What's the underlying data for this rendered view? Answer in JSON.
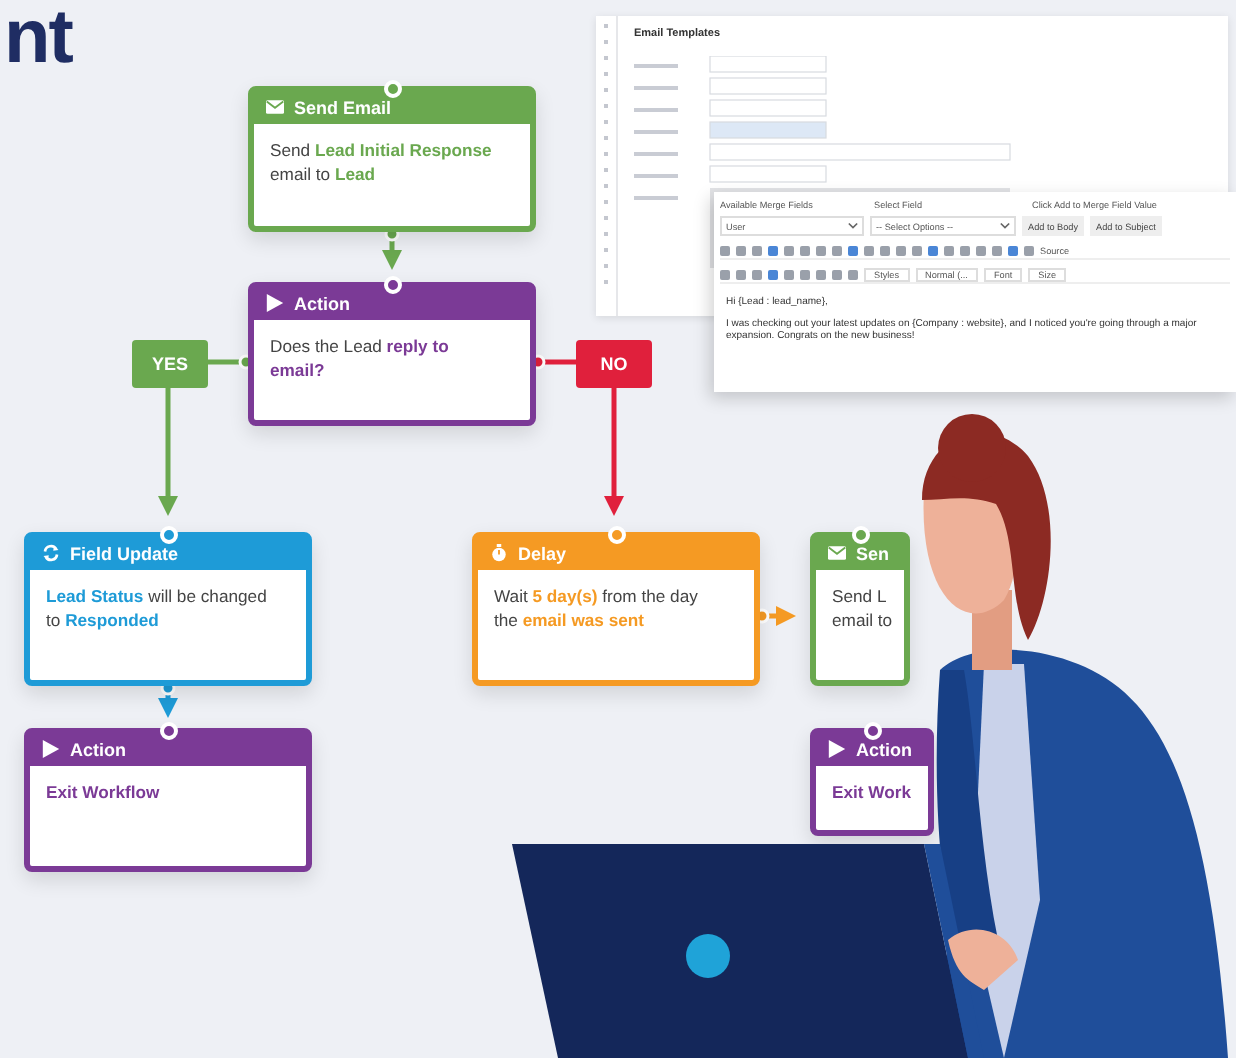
{
  "heading": {
    "text": "nt"
  },
  "email_template": {
    "title": "Email Templates",
    "merge_panel": {
      "labels": [
        "Available Merge Fields",
        "Select Field",
        "Click Add to Merge Field Value"
      ],
      "merge_field": {
        "value": "User"
      },
      "select_field": {
        "value": "-- Select Options --"
      },
      "buttons": [
        "Add to Body",
        "Add to Subject"
      ],
      "toolbar_source": "Source",
      "format_dropdowns": [
        "Styles",
        "Normal (...",
        "Font",
        "Size"
      ],
      "greeting": "Hi {Lead : lead_name},",
      "body": "I was checking out your latest updates on {Company : website}, and I noticed you're going through a major expansion. Congrats on the new business!"
    }
  },
  "nodes": [
    {
      "kind": "send_email",
      "title": "Send Email",
      "lines": [
        "Send **Lead Initial Response**",
        "email to **Lead**"
      ]
    },
    {
      "kind": "action",
      "title": "Action",
      "lines": [
        "Does the Lead **reply to**",
        "**email?**"
      ]
    },
    {
      "kind": "field_update",
      "title": "Field Update",
      "lines": [
        "**Lead Status** will be changed",
        "to **Responded**"
      ]
    },
    {
      "kind": "action",
      "title": "Action",
      "lines": [
        "**Exit Workflow**"
      ]
    },
    {
      "kind": "delay",
      "title": "Delay",
      "lines": [
        "Wait **5 day(s)** from the day",
        "the **email was sent**"
      ]
    },
    {
      "kind": "send_email",
      "title": "Sen",
      "lines": [
        "Send L",
        "email to"
      ]
    },
    {
      "kind": "action",
      "title": "Action",
      "lines": [
        "**Exit Work**"
      ]
    }
  ],
  "branches": [
    {
      "kind": "yes",
      "label": "YES"
    },
    {
      "kind": "no",
      "label": "NO"
    }
  ]
}
